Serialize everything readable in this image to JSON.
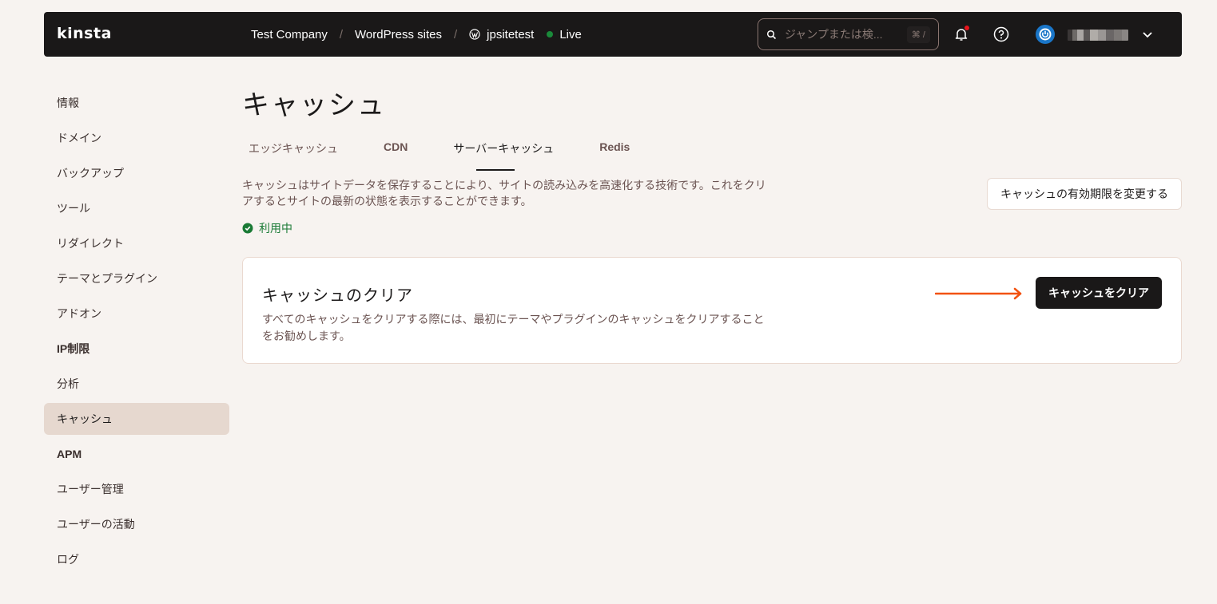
{
  "topbar": {
    "logo": "kinsta",
    "breadcrumb": [
      "Test Company",
      "WordPress sites",
      "jpsitetest"
    ],
    "separator": "/",
    "environment": "Live",
    "environment_color": "#1a8a3a",
    "search": {
      "placeholder": "ジャンプまたは検...",
      "shortcut": "⌘ /"
    },
    "icons": {
      "notifications": "bell-icon",
      "help": "help-circle-icon",
      "avatar": "power-icon",
      "menu": "chevron-down-icon"
    },
    "notification_dot_color": "#e8141c"
  },
  "sidebar": {
    "items": [
      {
        "label": "情報"
      },
      {
        "label": "ドメイン"
      },
      {
        "label": "バックアップ"
      },
      {
        "label": "ツール"
      },
      {
        "label": "リダイレクト"
      },
      {
        "label": "テーマとプラグイン"
      },
      {
        "label": "アドオン"
      },
      {
        "label": "IP制限"
      },
      {
        "label": "分析"
      },
      {
        "label": "キャッシュ",
        "active": true
      },
      {
        "label": "APM"
      },
      {
        "label": "ユーザー管理"
      },
      {
        "label": "ユーザーの活動"
      },
      {
        "label": "ログ"
      }
    ]
  },
  "main": {
    "title": "キャッシュ",
    "tabs": [
      {
        "label": "エッジキャッシュ"
      },
      {
        "label": "CDN"
      },
      {
        "label": "サーバーキャッシュ",
        "active": true
      },
      {
        "label": "Redis"
      }
    ],
    "description_line1": "キャッシュはサイトデータを保存することにより、サイトの読み込みを高速化する技術です。これをクリ",
    "description_line2": "アするとサイトの最新の状態を表示することができます。",
    "status": "利用中",
    "status_color": "#1a7a35",
    "expiry_button": "キャッシュの有効期限を変更する",
    "clear_card": {
      "title": "キャッシュのクリア",
      "description_line1": "すべてのキャッシュをクリアする際には、最初にテーマやプラグインのキャッシュをクリアすること",
      "description_line2": "をお勧めします。",
      "button": "キャッシュをクリア",
      "arrow_color": "#f2520f"
    }
  }
}
